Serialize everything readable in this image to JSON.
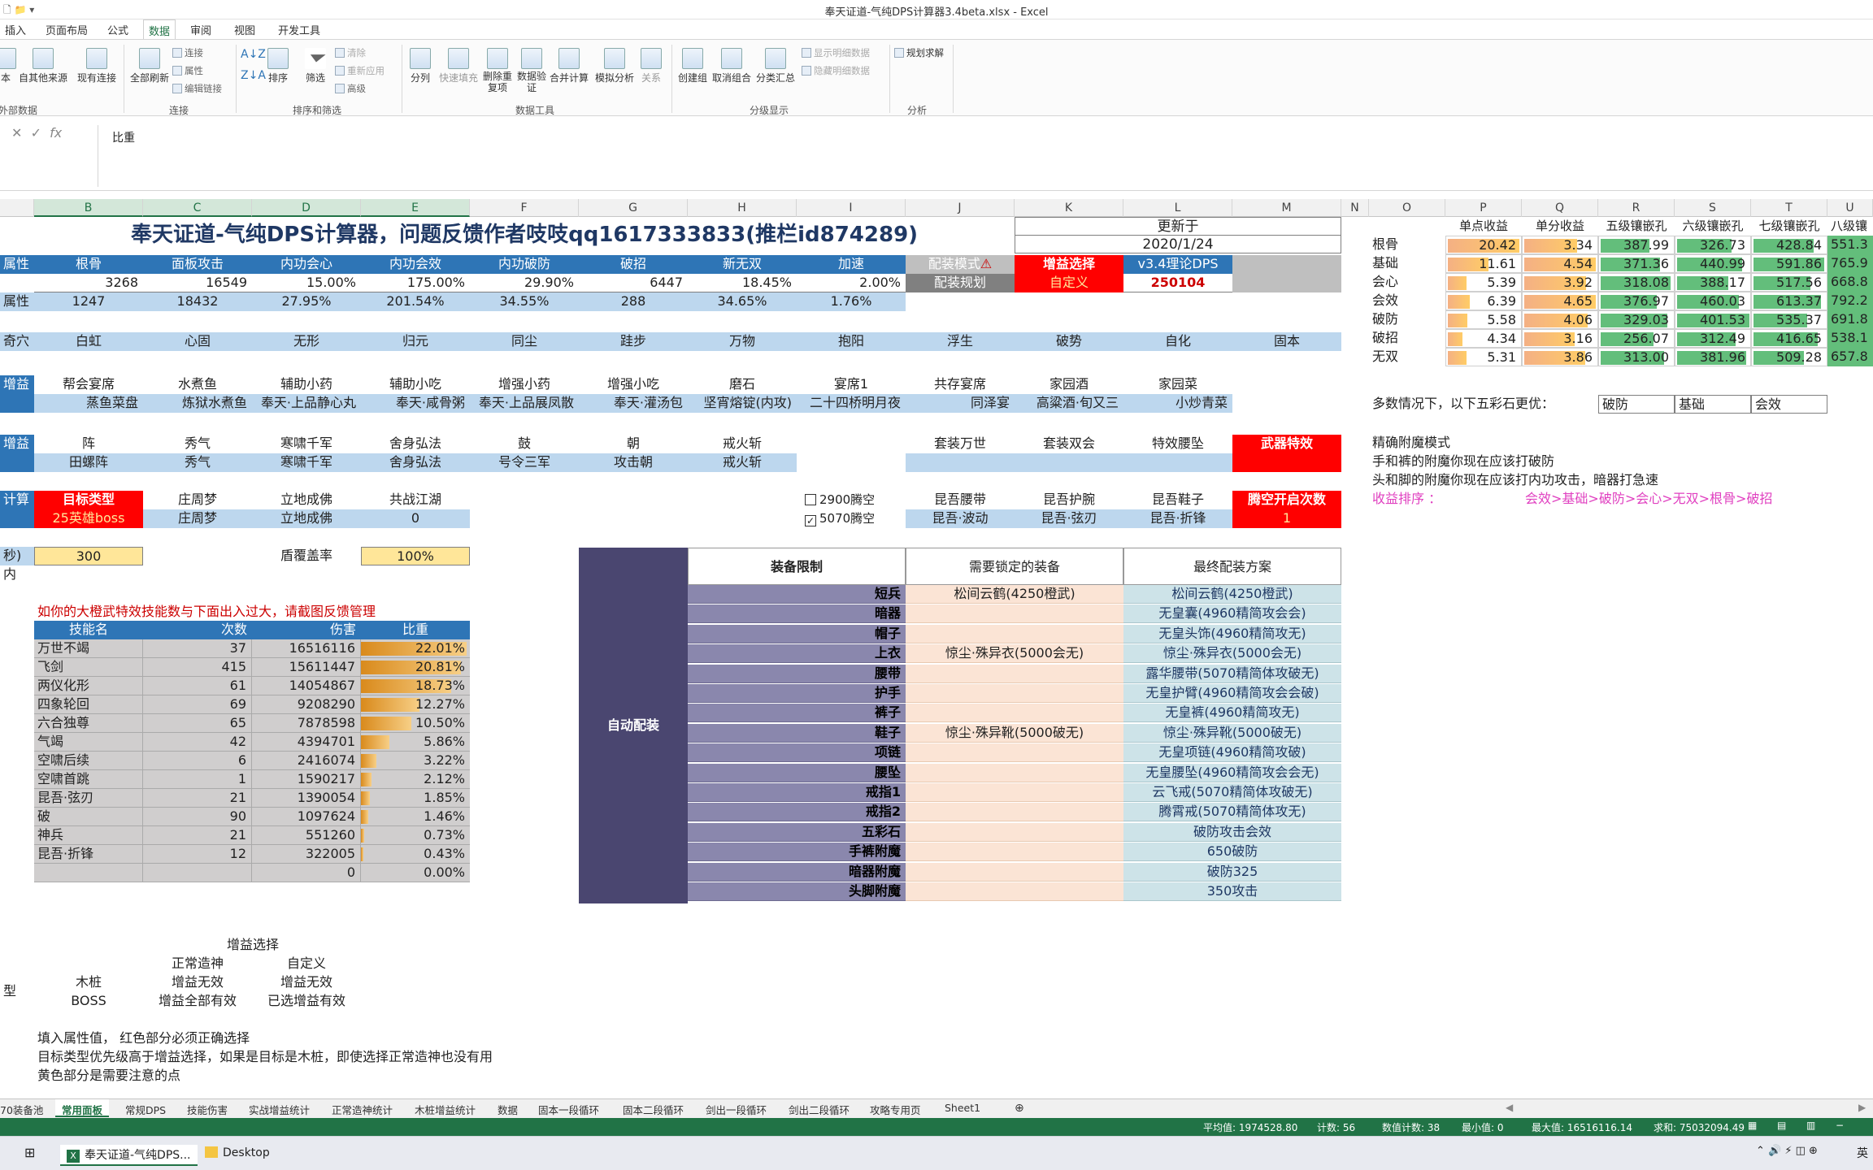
{
  "window": {
    "title": "奉天证道-气纯DPS计算器3.4beta.xlsx - Excel"
  },
  "ribbon_tabs": [
    "插入",
    "页面布局",
    "公式",
    "数据",
    "审阅",
    "视图",
    "开发工具"
  ],
  "ribbon": {
    "buttons": [
      "本",
      "自其他来源",
      "现有连接",
      "全部刷新",
      "排序",
      "筛选",
      "分列",
      "快速填充",
      "删除重复项",
      "数据验证",
      "合并计算",
      "模拟分析",
      "关系",
      "创建组",
      "取消组合",
      "分类汇总",
      "规划求解"
    ],
    "small": [
      "连接",
      "属性",
      "编辑链接",
      "清除",
      "重新应用",
      "高级",
      "显示明细数据",
      "隐藏明细数据"
    ],
    "groups": [
      "外部数据",
      "连接",
      "排序和筛选",
      "数据工具",
      "分级显示",
      "分析"
    ]
  },
  "formula": {
    "content": "比重"
  },
  "columns": [
    "B",
    "C",
    "D",
    "E",
    "F",
    "G",
    "H",
    "I",
    "J",
    "K",
    "L",
    "M",
    "N",
    "O",
    "P",
    "Q",
    "R",
    "S",
    "T",
    "U"
  ],
  "title": "奉天证道-气纯DPS计算器，问题反馈作者吱吱qq1617333833(推栏id874289)",
  "update": {
    "label": "更新于",
    "date": "2020/1/24"
  },
  "attr": {
    "header": [
      "属性",
      "根骨",
      "面板攻击",
      "内功会心",
      "内功会效",
      "内功破防",
      "破招",
      "新无双",
      "加速"
    ],
    "row1": [
      "",
      "3268",
      "16549",
      "15.00%",
      "175.00%",
      "29.90%",
      "6447",
      "18.45%",
      "2.00%"
    ],
    "row2": [
      "属性",
      "1247",
      "18432",
      "27.95%",
      "201.54%",
      "34.55%",
      "288",
      "34.65%",
      "1.76%"
    ]
  },
  "mode": {
    "label1": "配装模式",
    "warn": "⚠",
    "label2": "配装规划",
    "gain_label": "增益选择",
    "gain_val": "自定义",
    "dps_label": "v3.4理论DPS",
    "dps_val": "250104"
  },
  "qixue": {
    "label": "奇穴",
    "items": [
      "白虹",
      "心固",
      "无形",
      "归元",
      "同尘",
      "跬步",
      "万物",
      "抱阳",
      "浮生",
      "破势",
      "自化",
      "固本"
    ]
  },
  "buff1": {
    "label": "增益",
    "h": [
      "帮会宴席",
      "水煮鱼",
      "辅助小药",
      "辅助小吃",
      "增强小药",
      "增强小吃",
      "磨石",
      "宴席1",
      "共存宴席",
      "家园酒",
      "家园菜"
    ],
    "v": [
      "蒸鱼菜盘",
      "炼狱水煮鱼",
      "奉天·上品静心丸",
      "奉天·咸骨粥",
      "奉天·上品展凤散",
      "奉天·灌汤包",
      "坚宵熔锭(内攻)",
      "二十四桥明月夜",
      "同泽宴",
      "高粱酒·旬又三",
      "小炒青菜"
    ]
  },
  "buff2": {
    "label": "增益",
    "h": [
      "阵",
      "秀气",
      "寒啸千军",
      "舍身弘法",
      "鼓",
      "朝",
      "戒火斩"
    ],
    "v": [
      "田螺阵",
      "秀气",
      "寒啸千军",
      "舍身弘法",
      "号令三军",
      "攻击朝",
      "戒火斩"
    ],
    "set": [
      "套装万世",
      "套装双会",
      "特效腰坠"
    ],
    "weapon": "武器特效"
  },
  "calc": {
    "label": "计算",
    "target_label": "目标类型",
    "target_val": "25英雄boss",
    "h": [
      "庄周梦",
      "立地成佛",
      "共战江湖"
    ],
    "v": [
      "庄周梦",
      "立地成佛",
      "0"
    ],
    "cb1": "2900腾空",
    "cb2": "5070腾空",
    "cb2_mark": "✓",
    "set2h": [
      "昆吾腰带",
      "昆吾护腕",
      "昆吾鞋子"
    ],
    "set2v": [
      "昆吾·波动",
      "昆吾·弦刃",
      "昆吾·折锋"
    ],
    "tk_label": "腾空开启次数",
    "tk_val": "1"
  },
  "time": {
    "label": "秒)",
    "val": "300",
    "shield_label": "盾覆盖率",
    "shield_val": "100%",
    "in": "内"
  },
  "warn_text": "如你的大橙武特效技能数与下面出入过大，请截图反馈管理",
  "skills": {
    "h": [
      "技能名",
      "次数",
      "伤害",
      "比重"
    ],
    "rows": [
      [
        "万世不竭",
        "37",
        "16516116",
        "22.01%"
      ],
      [
        "飞剑",
        "415",
        "15611447",
        "20.81%"
      ],
      [
        "两仪化形",
        "61",
        "14054867",
        "18.73%"
      ],
      [
        "四象轮回",
        "69",
        "9208290",
        "12.27%"
      ],
      [
        "六合独尊",
        "65",
        "7878598",
        "10.50%"
      ],
      [
        "气竭",
        "42",
        "4394701",
        "5.86%"
      ],
      [
        "空啸后续",
        "6",
        "2416074",
        "3.22%"
      ],
      [
        "空啸首跳",
        "1",
        "1590217",
        "2.12%"
      ],
      [
        "昆吾·弦刃",
        "21",
        "1390054",
        "1.85%"
      ],
      [
        "破",
        "90",
        "1097624",
        "1.46%"
      ],
      [
        "神兵",
        "21",
        "551260",
        "0.73%"
      ],
      [
        "昆吾·折锋",
        "12",
        "322005",
        "0.43%"
      ],
      [
        "",
        "",
        "0",
        "0.00%"
      ]
    ],
    "pct": [
      22.01,
      20.81,
      18.73,
      12.27,
      10.5,
      5.86,
      3.22,
      2.12,
      1.85,
      1.46,
      0.73,
      0.43,
      0
    ]
  },
  "auto": {
    "label": "自动配装",
    "h": [
      "装备限制",
      "需要锁定的装备",
      "最终配装方案"
    ],
    "slots": [
      "短兵",
      "暗器",
      "帽子",
      "上衣",
      "腰带",
      "护手",
      "裤子",
      "鞋子",
      "项链",
      "腰坠",
      "戒指1",
      "戒指2",
      "五彩石",
      "手裤附魔",
      "暗器附魔",
      "头脚附魔"
    ],
    "locked": [
      "松间云鹤(4250橙武)",
      "",
      "",
      "惊尘·殊异衣(5000会无)",
      "",
      "",
      "",
      "惊尘·殊异靴(5000破无)",
      "",
      "",
      "",
      "",
      "",
      "",
      "",
      ""
    ],
    "final": [
      "松间云鹤(4250橙武)",
      "无皇囊(4960精简攻会会)",
      "无皇头饰(4960精简攻无)",
      "惊尘·殊异衣(5000会无)",
      "露华腰带(5070精简体攻破无)",
      "无皇护臂(4960精简攻会会破)",
      "无皇裤(4960精简攻无)",
      "惊尘·殊异靴(5000破无)",
      "无皇项链(4960精简攻破)",
      "无皇腰坠(4960精简攻会会无)",
      "云飞戒(5070精简体攻破无)",
      "腾霄戒(5070精简体攻无)",
      "破防攻击会效",
      "650破防",
      "破防325",
      "350攻击"
    ]
  },
  "gains": {
    "h": [
      "单点收益",
      "单分收益",
      "五级镶嵌孔",
      "六级镶嵌孔",
      "七级镶嵌孔",
      "八级镶"
    ],
    "rows": [
      [
        "根骨",
        "20.42",
        "3.34",
        "387.99",
        "326.73",
        "428.84",
        "551.3"
      ],
      [
        "基础",
        "11.61",
        "4.54",
        "371.36",
        "440.99",
        "591.86",
        "765.9"
      ],
      [
        "会心",
        "5.39",
        "3.92",
        "318.08",
        "388.17",
        "517.56",
        "668.8"
      ],
      [
        "会效",
        "6.39",
        "4.65",
        "376.97",
        "460.03",
        "613.37",
        "792.2"
      ],
      [
        "破防",
        "5.58",
        "4.06",
        "329.03",
        "401.53",
        "535.37",
        "691.8"
      ],
      [
        "破招",
        "4.34",
        "3.16",
        "256.07",
        "312.49",
        "416.65",
        "538.1"
      ],
      [
        "无双",
        "5.31",
        "3.86",
        "313.00",
        "381.96",
        "509.28",
        "657.8"
      ]
    ],
    "p_pct": [
      1.0,
      0.57,
      0.26,
      0.31,
      0.27,
      0.21,
      0.26
    ],
    "q_pct": [
      0.74,
      1.0,
      0.86,
      1.0,
      0.89,
      0.7,
      0.85
    ]
  },
  "stone": {
    "label": "多数情况下，以下五彩石更优：",
    "v": [
      "破防",
      "基础",
      "会效"
    ]
  },
  "enchant": {
    "l1": "精确附魔模式",
    "l2": "手和裤的附魔你现在应该打破防",
    "l3": "头和脚的附魔你现在应该打内功攻击，暗器打急速",
    "sort_label": "收益排序 ：",
    "sort_val": "会效>基础>破防>会心>无双>根骨>破招"
  },
  "gain_table": {
    "title": "增益选择",
    "c1": "正常造神",
    "c2": "自定义",
    "r1": "木桩",
    "r1a": "增益无效",
    "r1b": "增益无效",
    "r2": "BOSS",
    "r2a": "增益全部有效",
    "r2b": "已选增益有效",
    "side": "型"
  },
  "notes": [
    "填入属性值， 红色部分必须正确选择",
    "目标类型优先级高于增益选择，如果是目标是木桩，即使选择正常造神也没有用",
    "黄色部分是需要注意的点"
  ],
  "sheet_tabs": [
    "70装备池",
    "常用面板",
    "常规DPS",
    "技能伤害",
    "实战增益统计",
    "正常造神统计",
    "木桩增益统计",
    "数据",
    "固本一段循环",
    "固本二段循环",
    "剑出一段循环",
    "剑出二段循环",
    "攻略专用页",
    "Sheet1"
  ],
  "active_sheet": "常用面板",
  "status": {
    "avg": "平均值: 1974528.80",
    "count": "计数: 56",
    "ncount": "数值计数: 38",
    "min": "最小值: 0",
    "max": "最大值: 16516116.14",
    "sum": "求和: 75032094.49"
  },
  "taskbar": {
    "app1": "奉天证道-气纯DPS...",
    "app2": "Desktop",
    "lang": "英"
  }
}
